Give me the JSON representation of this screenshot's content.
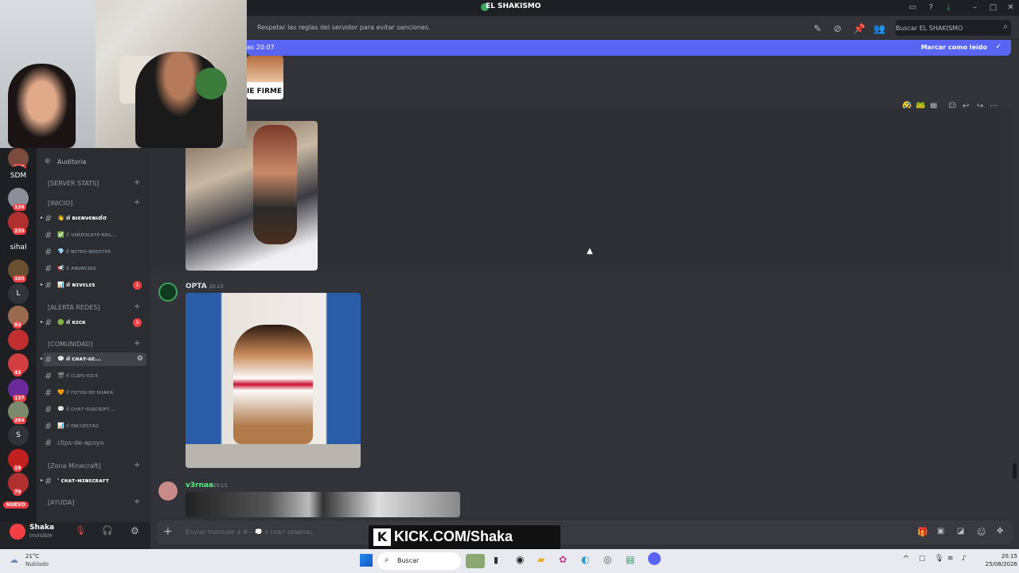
{
  "window": {
    "title": "EL SHAKISMO"
  },
  "channel_header": {
    "topic": "Respetar las reglas del servidor para evitar sanciones.",
    "search_placeholder": "Buscar EL SHAKISMO"
  },
  "new_messages_bar": {
    "left_text": "as 20:07",
    "mark_read": "Marcar como leído"
  },
  "guilds": [
    {
      "label": "",
      "badge": "161",
      "color": "#7a4a3a"
    },
    {
      "label": "SDM",
      "badge": "",
      "color": "#1e1f22"
    },
    {
      "label": "",
      "badge": "136",
      "color": "#8a8f99"
    },
    {
      "label": "",
      "badge": "230",
      "color": "#b03030"
    },
    {
      "label": "sihal",
      "badge": "",
      "color": "#1e1f22"
    },
    {
      "label": "",
      "badge": "100",
      "color": "#6a5030"
    },
    {
      "label": "L",
      "badge": "",
      "color": "#313338"
    },
    {
      "label": "",
      "badge": "83",
      "color": "#9a6a50"
    },
    {
      "label": "",
      "badge": "",
      "color": "#c03030"
    },
    {
      "label": "",
      "badge": "43",
      "color": "#d04040"
    },
    {
      "label": "",
      "badge": "137",
      "color": "#6a2a9a"
    },
    {
      "label": "",
      "badge": "284",
      "color": "#7a8a6a"
    },
    {
      "label": "S",
      "badge": "",
      "color": "#313338"
    },
    {
      "label": "",
      "badge": "19",
      "color": "#c02020"
    },
    {
      "label": "",
      "badge": "79",
      "color": "#b03030"
    }
  ],
  "guild_new_label": "NUEVO",
  "sidebar": {
    "auditoria": "Auditoria",
    "categories": [
      {
        "label": "[SERVER STATS]"
      },
      {
        "label": "[INICIO]"
      },
      {
        "label": "[ALERTA REDES]"
      },
      {
        "label": "[COMUNIDAD]"
      },
      {
        "label": "[Zona Minecraft]"
      },
      {
        "label": "[AYUDA]"
      }
    ],
    "channels": [
      {
        "label": "ıl ʙιєɴνєɴιɗσ",
        "bold": true,
        "emoji": "👋",
        "badge": ""
      },
      {
        "label": "ıl ᴠᴇʀɪꜰɪᴄᴀᴛᴇ-ʀᴇɢ...",
        "bold": false,
        "emoji": "✅",
        "badge": ""
      },
      {
        "label": "ıl ɴɪᴛʀᴏ-ʙᴏᴏꜱᴛᴇʀ",
        "bold": false,
        "emoji": "💎",
        "badge": ""
      },
      {
        "label": "ıl ᴀɴᴜɴᴄɪᴏꜱ",
        "bold": false,
        "emoji": "📢",
        "badge": ""
      },
      {
        "label": "ıl ɴɪᴠᴇʟᴇꜱ",
        "bold": true,
        "emoji": "📊",
        "badge": "1"
      },
      {
        "label": "ıl ᴋɪᴄᴋ",
        "bold": true,
        "emoji": "🟢",
        "badge": "9"
      },
      {
        "label": "ıl ᴄʜᴀᴛ-ɢᴇ...",
        "bold": true,
        "emoji": "💬",
        "badge": ""
      },
      {
        "label": "ıl ᴄʟɪᴘꜱ-ᴋɪᴄᴋ",
        "bold": false,
        "emoji": "🎬",
        "badge": ""
      },
      {
        "label": "ıl ꜰᴏᴛᴏꜱ-ᴅᴇ-ꜱʜᴀᴋᴀ",
        "bold": false,
        "emoji": "🧡",
        "badge": ""
      },
      {
        "label": "ıl ᴄʜᴀᴛ-ꜱᴜꜱᴄʀɪᴘᴛ...",
        "bold": false,
        "emoji": "💬",
        "badge": ""
      },
      {
        "label": "ıl ᴇɴᴄᴜᴇꜱᴛᴀꜱ",
        "bold": false,
        "emoji": "📊",
        "badge": ""
      },
      {
        "label": "clips-de-apoyo",
        "bold": false,
        "emoji": "",
        "badge": ""
      },
      {
        "label": "' ᴄʜᴀᴛ-ᴍɪɴᴇᴄʀᴀꜰᴛ",
        "bold": true,
        "emoji": "",
        "badge": ""
      }
    ]
  },
  "user": {
    "name": "Shaka",
    "status": "Invisible"
  },
  "messages": [
    {
      "author": "OPTA",
      "time": "20:13",
      "color": "#dbdee1"
    },
    {
      "author": "v3rnaa",
      "time": "20:13",
      "color": "#57f287"
    }
  ],
  "image_caption_partial": "IE FIRME",
  "composer": {
    "placeholder": "Enviar mensaje a #-- 💭 ıl ᴄʜᴀᴛ-ɢᴇɴᴇʀᴀʟ"
  },
  "overlay": {
    "kick_text": "KICK.COM/Shaka"
  },
  "taskbar": {
    "temp": "21°C",
    "weather": "Nublado",
    "search": "Buscar",
    "time": "20:15",
    "date": "25/08/2026"
  }
}
